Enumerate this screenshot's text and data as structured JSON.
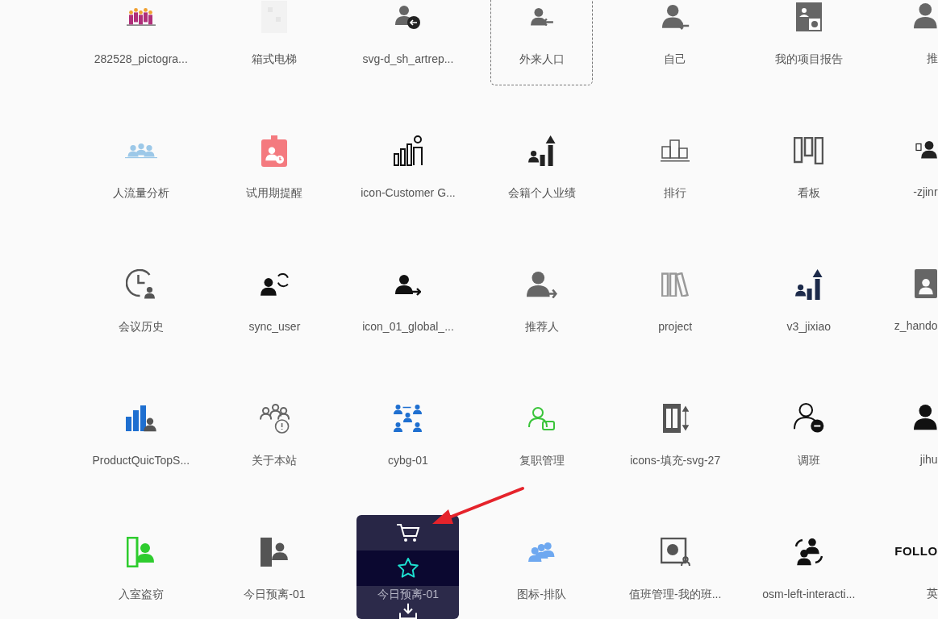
{
  "icons": [
    {
      "label": "282528_pictogra...",
      "selected": false,
      "hovered": false
    },
    {
      "label": "箱式电梯",
      "selected": false,
      "hovered": false
    },
    {
      "label": "svg-d_sh_artrep...",
      "selected": false,
      "hovered": false
    },
    {
      "label": "外来人口",
      "selected": true,
      "hovered": false
    },
    {
      "label": "自己",
      "selected": false,
      "hovered": false
    },
    {
      "label": "我的项目报告",
      "selected": false,
      "hovered": false
    },
    {
      "label": "推",
      "selected": false,
      "hovered": false
    },
    {
      "label": "人流量分析",
      "selected": false,
      "hovered": false
    },
    {
      "label": "试用期提醒",
      "selected": false,
      "hovered": false
    },
    {
      "label": "icon-Customer G...",
      "selected": false,
      "hovered": false
    },
    {
      "label": "会籍个人业绩",
      "selected": false,
      "hovered": false
    },
    {
      "label": "排行",
      "selected": false,
      "hovered": false
    },
    {
      "label": "看板",
      "selected": false,
      "hovered": false
    },
    {
      "label": "-zjinr",
      "selected": false,
      "hovered": false
    },
    {
      "label": "会议历史",
      "selected": false,
      "hovered": false
    },
    {
      "label": "sync_user",
      "selected": false,
      "hovered": false
    },
    {
      "label": "icon_01_global_...",
      "selected": false,
      "hovered": false
    },
    {
      "label": "推荐人",
      "selected": false,
      "hovered": false
    },
    {
      "label": "project",
      "selected": false,
      "hovered": false
    },
    {
      "label": "v3_jixiao",
      "selected": false,
      "hovered": false
    },
    {
      "label": "z_hando",
      "selected": false,
      "hovered": false
    },
    {
      "label": "ProductQuicTopS...",
      "selected": false,
      "hovered": false
    },
    {
      "label": "关于本站",
      "selected": false,
      "hovered": false
    },
    {
      "label": "cybg-01",
      "selected": false,
      "hovered": false
    },
    {
      "label": "复职管理",
      "selected": false,
      "hovered": false
    },
    {
      "label": "icons-填充-svg-27",
      "selected": false,
      "hovered": false
    },
    {
      "label": "调班",
      "selected": false,
      "hovered": false
    },
    {
      "label": "jihu",
      "selected": false,
      "hovered": false
    },
    {
      "label": "入室盗窃",
      "selected": false,
      "hovered": false
    },
    {
      "label": "今日预离-01",
      "selected": false,
      "hovered": false
    },
    {
      "label": "今日预离-01",
      "selected": false,
      "hovered": true
    },
    {
      "label": "图标-排队",
      "selected": false,
      "hovered": false
    },
    {
      "label": "值班管理-我的班...",
      "selected": false,
      "hovered": false
    },
    {
      "label": "osm-left-interacti...",
      "selected": false,
      "hovered": false
    },
    {
      "label": "英",
      "selected": false,
      "hovered": false,
      "icon_text": "FOLLO"
    }
  ]
}
